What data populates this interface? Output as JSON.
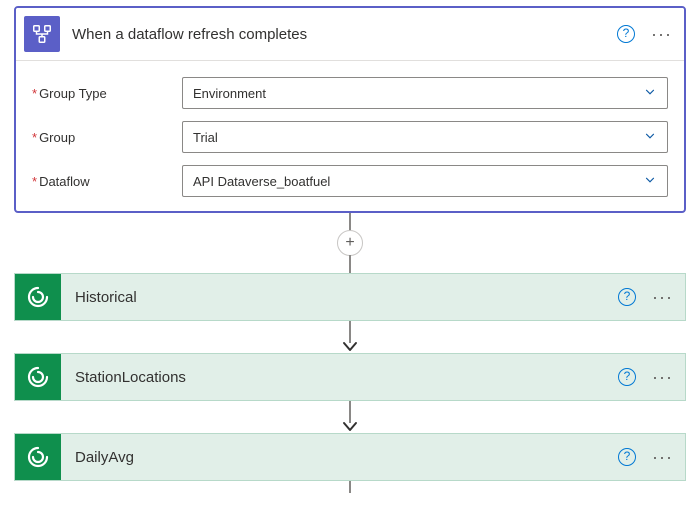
{
  "trigger": {
    "title": "When a dataflow refresh completes",
    "fields": [
      {
        "label": "Group Type",
        "value": "Environment"
      },
      {
        "label": "Group",
        "value": "Trial"
      },
      {
        "label": "Dataflow",
        "value": "API Dataverse_boatfuel"
      }
    ]
  },
  "actions": [
    {
      "title": "Historical"
    },
    {
      "title": "StationLocations"
    },
    {
      "title": "DailyAvg"
    }
  ],
  "glyphs": {
    "help": "?",
    "more": "···",
    "plus": "+",
    "required": "*"
  }
}
